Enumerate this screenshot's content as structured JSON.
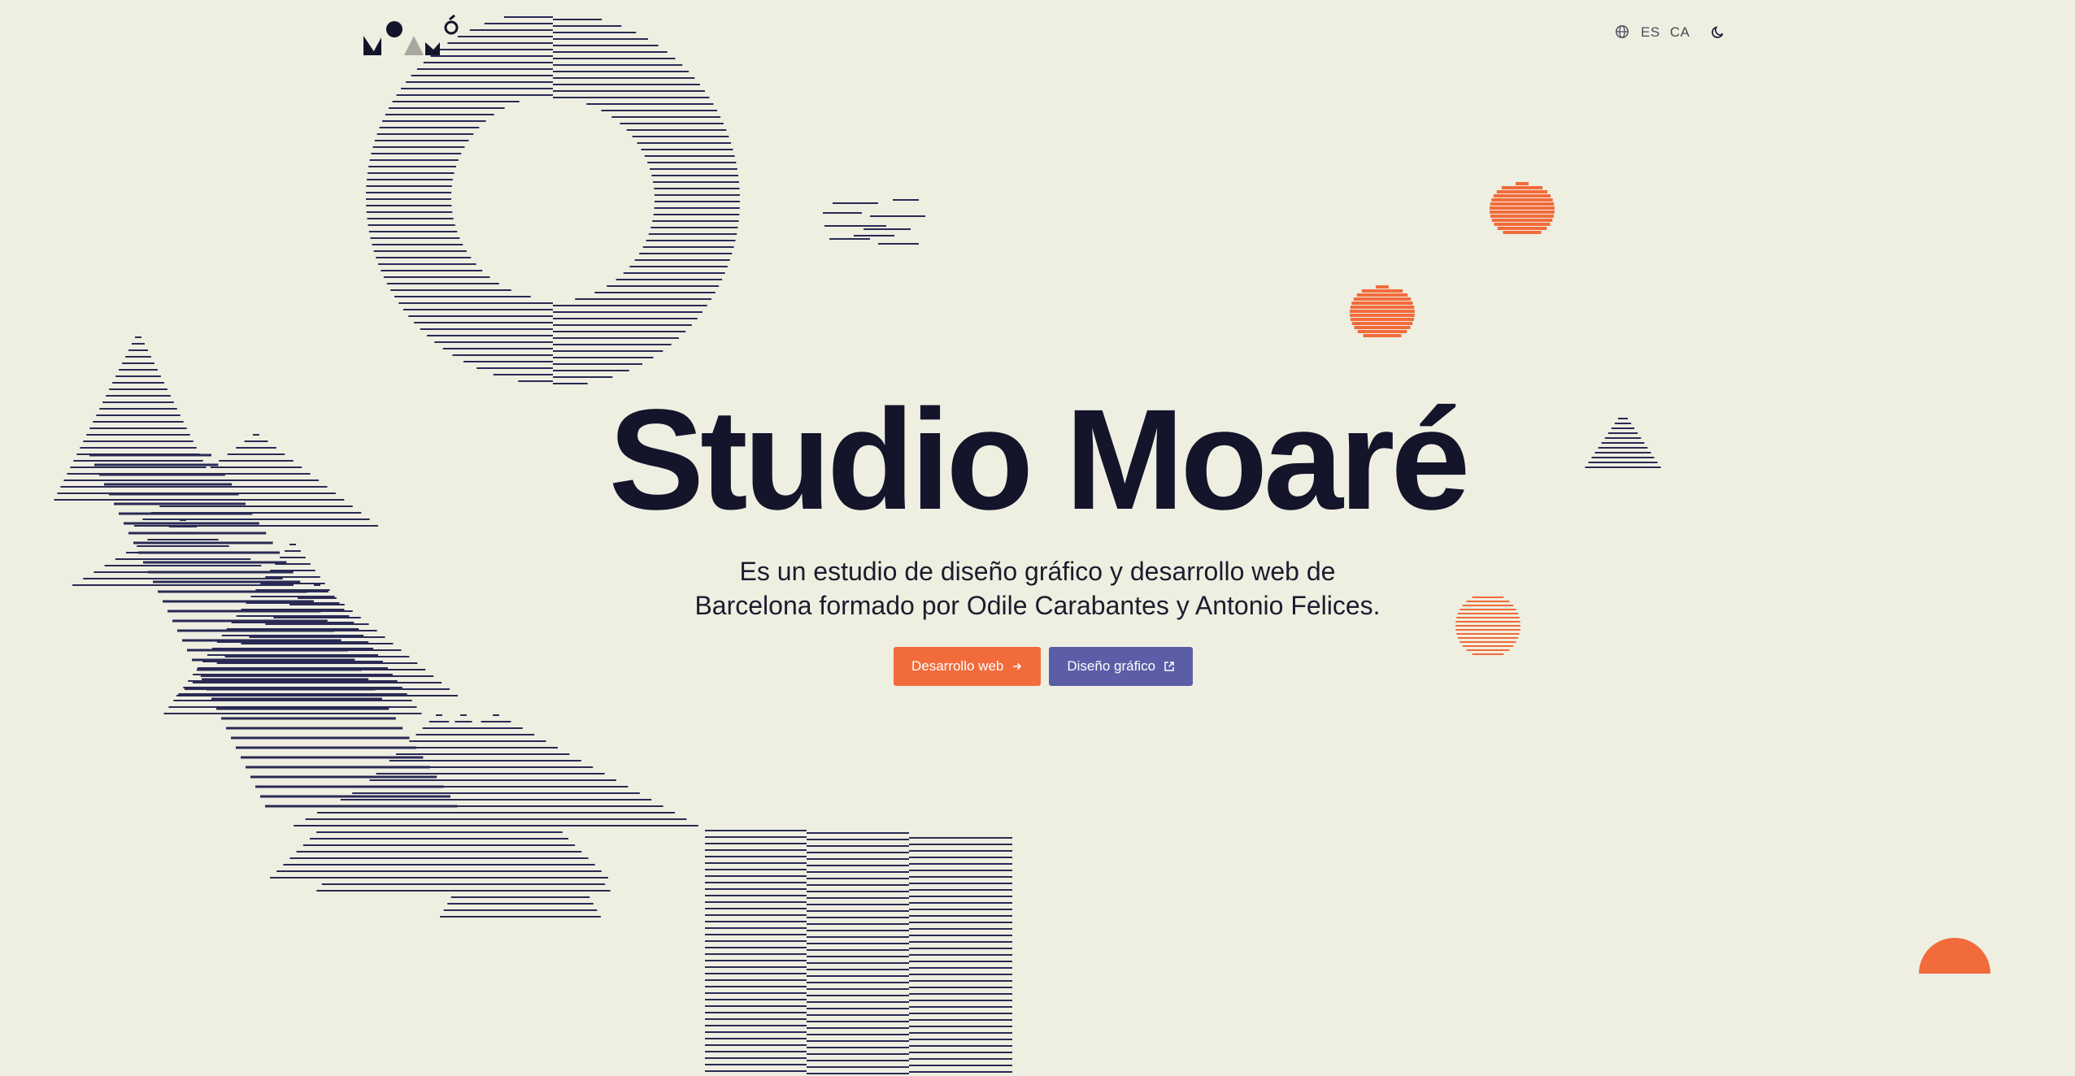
{
  "header": {
    "brand": "Studio Moaré",
    "language_options": [
      "ES",
      "CA"
    ],
    "icons": [
      "globe-icon",
      "moon-icon"
    ]
  },
  "hero": {
    "title": "Studio Moaré",
    "description_line1": "Es un estudio de diseño gráfico y desarrollo web de",
    "description_line2": "Barcelona formado por Odile Carabantes y Antonio Felices.",
    "buttons": [
      {
        "label": "Desarrollo web",
        "icon": "arrow-right-icon"
      },
      {
        "label": "Diseño gráfico",
        "icon": "external-link-icon"
      }
    ]
  },
  "colors": {
    "background": "#eeefe1",
    "ink": "#14142b",
    "accent_orange": "#f26b3a",
    "accent_indigo": "#5b5ea6",
    "stripe": "#2a2a55"
  }
}
